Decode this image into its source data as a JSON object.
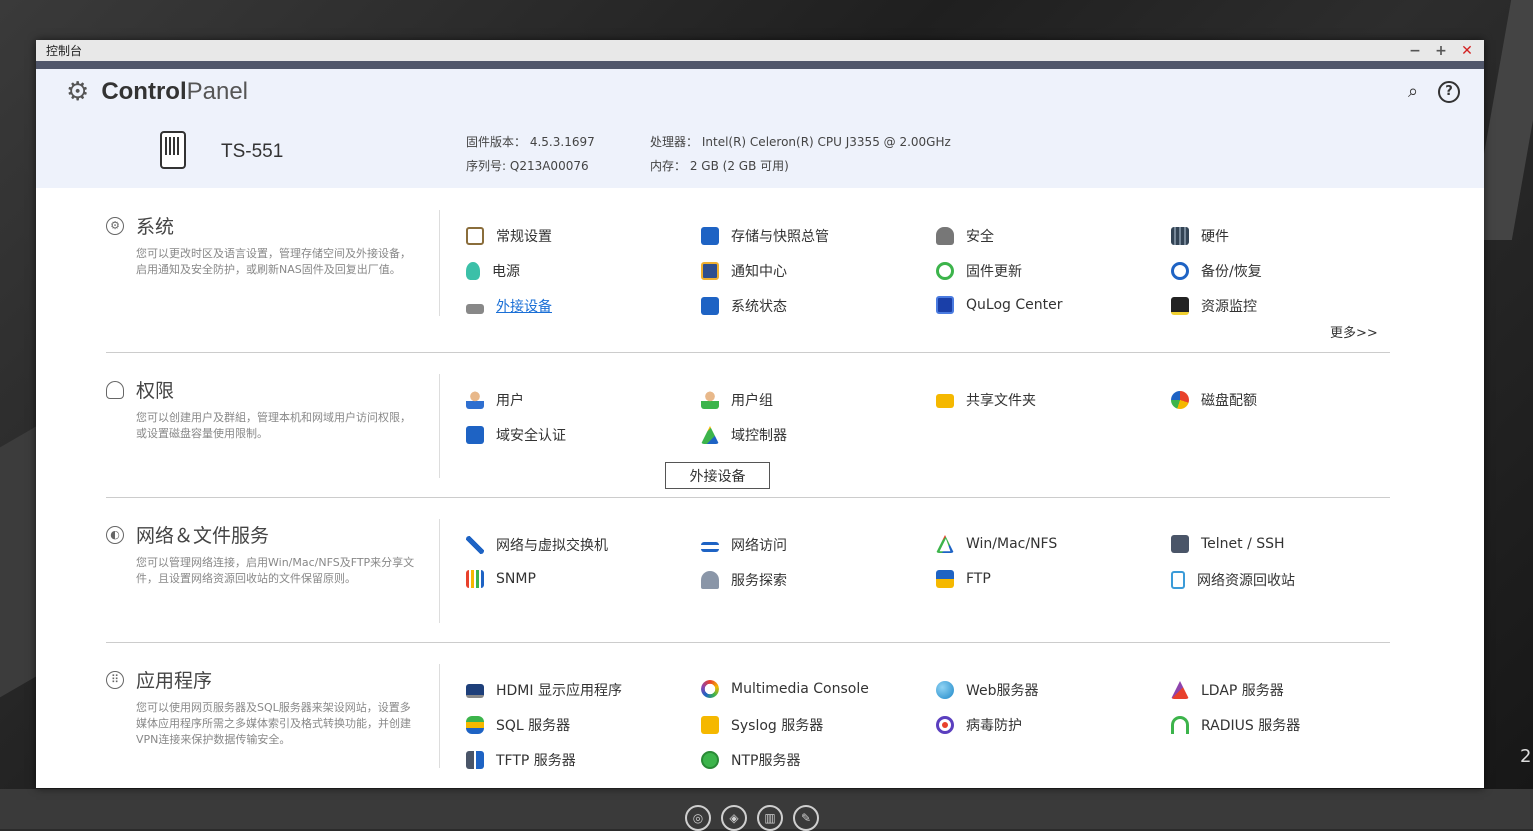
{
  "window": {
    "title": "控制台",
    "minimize": "−",
    "maximize": "+",
    "close": "✕"
  },
  "header": {
    "title_bold": "Control",
    "title_light": "Panel",
    "model": "TS-551",
    "firmware_label": "固件版本：",
    "firmware_value": "4.5.3.1697",
    "serial_label": "序列号:",
    "serial_value": "Q213A00076",
    "cpu_label": "处理器：",
    "cpu_value": "Intel(R) Celeron(R) CPU J3355 @ 2.00GHz",
    "memory_label": "内存：",
    "memory_value": "2 GB (2 GB 可用)"
  },
  "sections": {
    "system": {
      "title": "系统",
      "desc": "您可以更改时区及语言设置，管理存储空间及外接设备，启用通知及安全防护，或刷新NAS固件及回复出厂值。",
      "items": [
        "常规设置",
        "存储与快照总管",
        "安全",
        "硬件",
        "电源",
        "通知中心",
        "固件更新",
        "备份/恢复",
        "外接设备",
        "系统状态",
        "QuLog Center",
        "资源监控"
      ],
      "more": "更多>>"
    },
    "privilege": {
      "title": "权限",
      "desc": "您可以创建用户及群組，管理本机和网域用户访问权限，或设置磁盘容量使用限制。",
      "items": [
        "用户",
        "用户组",
        "共享文件夹",
        "磁盘配额",
        "域安全认证",
        "域控制器"
      ]
    },
    "network": {
      "title": "网络＆文件服务",
      "desc": "您可以管理网络连接，启用Win/Mac/NFS及FTP来分享文件，且设置网络资源回收站的文件保留原则。",
      "items": [
        "网络与虚拟交换机",
        "网络访问",
        "Win/Mac/NFS",
        "Telnet / SSH",
        "SNMP",
        "服务探索",
        "FTP",
        "网络资源回收站"
      ]
    },
    "apps": {
      "title": "应用程序",
      "desc": "您可以使用网页服务器及SQL服务器来架设网站，设置多媒体应用程序所需之多媒体索引及格式转换功能，并创建VPN连接来保护数据传输安全。",
      "items": [
        "HDMI 显示应用程序",
        "Multimedia Console",
        "Web服务器",
        "LDAP 服务器",
        "SQL 服务器",
        "Syslog 服务器",
        "病毒防护",
        "RADIUS 服务器",
        "TFTP 服务器",
        "NTP服务器"
      ]
    }
  },
  "tooltip": "外接设备",
  "edge_number": "2",
  "icons": {
    "header_gear": "gear-icon",
    "search": "search-icon",
    "help": "help-icon"
  }
}
